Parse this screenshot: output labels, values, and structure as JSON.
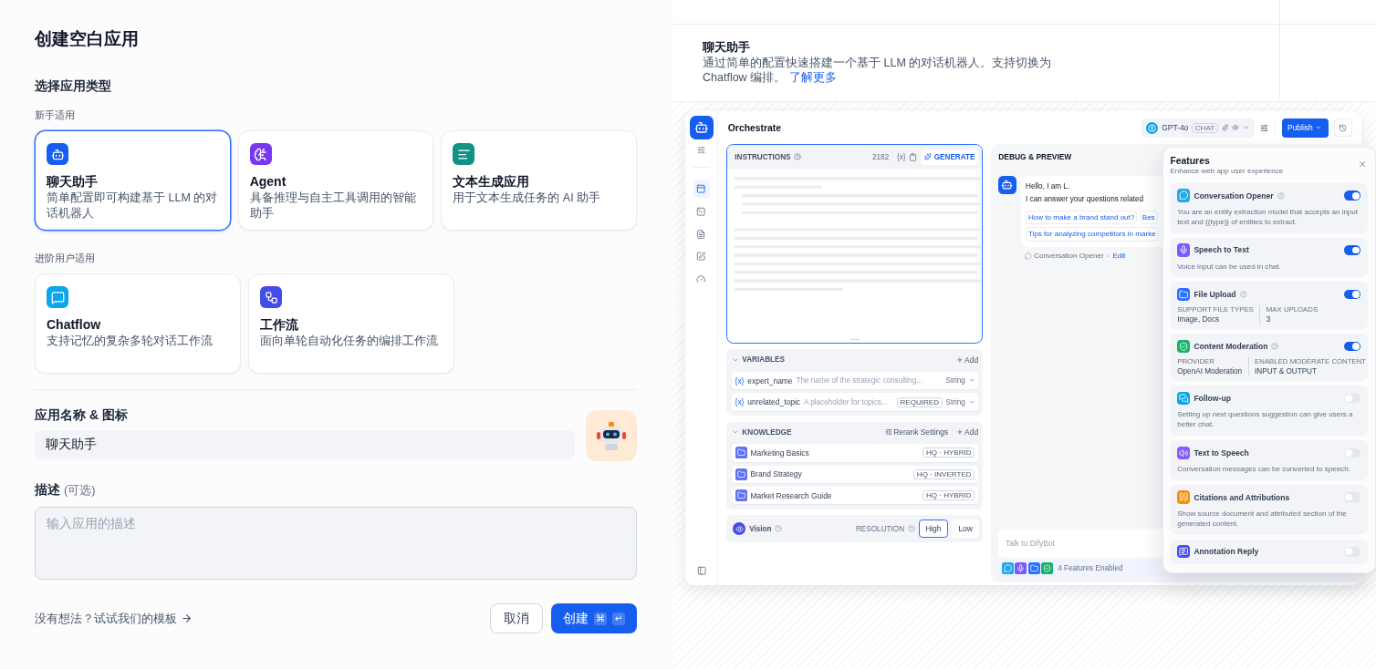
{
  "title": "创建空白应用",
  "type_heading": "选择应用类型",
  "groups": [
    {
      "label": "新手适用",
      "cards": [
        {
          "kind": "chat",
          "title": "聊天助手",
          "description": "简单配置即可构建基于 LLM 的对话机器人",
          "selected": true
        },
        {
          "kind": "agent",
          "title": "Agent",
          "description": "具备推理与自主工具调用的智能助手",
          "selected": false
        },
        {
          "kind": "completion",
          "title": "文本生成应用",
          "description": "用于文本生成任务的 AI 助手",
          "selected": false
        }
      ]
    },
    {
      "label": "进阶用户适用",
      "cards": [
        {
          "kind": "chatflow",
          "title": "Chatflow",
          "description": "支持记忆的复杂多轮对话工作流",
          "selected": false
        },
        {
          "kind": "workflow",
          "title": "工作流",
          "description": "面向单轮自动化任务的编排工作流",
          "selected": false
        }
      ]
    }
  ],
  "name_field": {
    "label": "应用名称 & 图标",
    "value": "聊天助手"
  },
  "description_field": {
    "label": "描述",
    "hint": "(可选)",
    "placeholder": "输入应用的描述"
  },
  "footer": {
    "template_link": "没有想法？试试我们的模板",
    "cancel": "取消",
    "create": "创建",
    "create_keys": [
      "⌘",
      "↵"
    ]
  },
  "preview": {
    "title": "聊天助手",
    "description": "通过简单的配置快速搭建一个基于 LLM 的对话机器人。支持切换为 Chatflow 编排。",
    "learn_more": "了解更多",
    "app": {
      "title": "Orchestrate",
      "model": {
        "name": "GPT-4o",
        "mode": "CHAT"
      },
      "publish": "Publish",
      "instructions": {
        "label": "INSTRUCTIONS",
        "count": "2182",
        "var_token": "{x}",
        "generate": "GENERATE"
      },
      "variables": {
        "label": "VARIABLES",
        "add": "Add",
        "required_label": "REQUIRED",
        "rows": [
          {
            "token": "{x}",
            "name": "expert_name",
            "description": "The name of the strategic consulting...",
            "required": false,
            "type": "String"
          },
          {
            "token": "{x}",
            "name": "unrelated_topic",
            "description": "A placeholder for topics...",
            "required": true,
            "type": "String"
          }
        ]
      },
      "knowledge": {
        "label": "KNOWLEDGE",
        "rerank": "Rerank Settings",
        "add": "Add",
        "rows": [
          {
            "name": "Marketing Basics",
            "tag": "HQ · HYBRID"
          },
          {
            "name": "Brand Strategy",
            "tag": "HQ · INVERTED"
          },
          {
            "name": "Market Research Guide",
            "tag": "HQ · HYBRID"
          }
        ]
      },
      "vision": {
        "label": "Vision",
        "resolution_label": "RESOLUTION",
        "options": [
          {
            "label": "High",
            "selected": true
          },
          {
            "label": "Low",
            "selected": false
          }
        ]
      },
      "debug": {
        "title": "DEBUG & PREVIEW",
        "greeting": [
          "Hello, I am L.",
          "I can answer your questions related"
        ],
        "suggestions": [
          "How to make a brand stand out?",
          "Bes",
          "Tips for analyzing competitors in marke"
        ],
        "opener_label": "Conversation Opener",
        "edit": "Edit",
        "input_placeholder": "Talk to DifyBot",
        "enabled_features": "4 Features Enabled"
      },
      "features": {
        "title": "Features",
        "subtitle": "Enhance web app user experience",
        "items": [
          {
            "kind": "text",
            "name": "Conversation Opener",
            "help": true,
            "on": true,
            "color": "#1fa9e8",
            "description": "You are an entity extraction model that accepts an input text and {{type}} of entities to extract."
          },
          {
            "kind": "text",
            "name": "Speech to Text",
            "help": false,
            "on": true,
            "color": "#7a5af8",
            "description": "Voice input can be used in chat."
          },
          {
            "kind": "fields",
            "name": "File Upload",
            "help": true,
            "on": true,
            "color": "#2970ff",
            "fields": [
              {
                "label": "SUPPORT FILE TYPES",
                "value": "Image, Docs"
              },
              {
                "label": "MAX UPLOADS",
                "value": "3"
              }
            ]
          },
          {
            "kind": "fields",
            "name": "Content Moderation",
            "help": true,
            "on": true,
            "color": "#17b26a",
            "fields": [
              {
                "label": "PROVIDER",
                "value": "OpenAI Moderation"
              },
              {
                "label": "ENABLED MODERATE CONTENT",
                "value": "INPUT & OUTPUT"
              }
            ]
          },
          {
            "kind": "text",
            "name": "Follow-up",
            "help": false,
            "on": false,
            "color": "#0ba5ec",
            "description": "Setting up next questions suggestion can give users a better chat."
          },
          {
            "kind": "text",
            "name": "Text to Speech",
            "help": false,
            "on": false,
            "color": "#875bf7",
            "description": "Conversation messages can be converted to speech."
          },
          {
            "kind": "text",
            "name": "Citations and Attributions",
            "help": false,
            "on": false,
            "color": "#f79009",
            "description": "Show source document and attributed section of the generated content."
          },
          {
            "kind": "text",
            "name": "Annotation Reply",
            "help": false,
            "on": false,
            "color": "#444ce7"
          }
        ]
      }
    }
  }
}
